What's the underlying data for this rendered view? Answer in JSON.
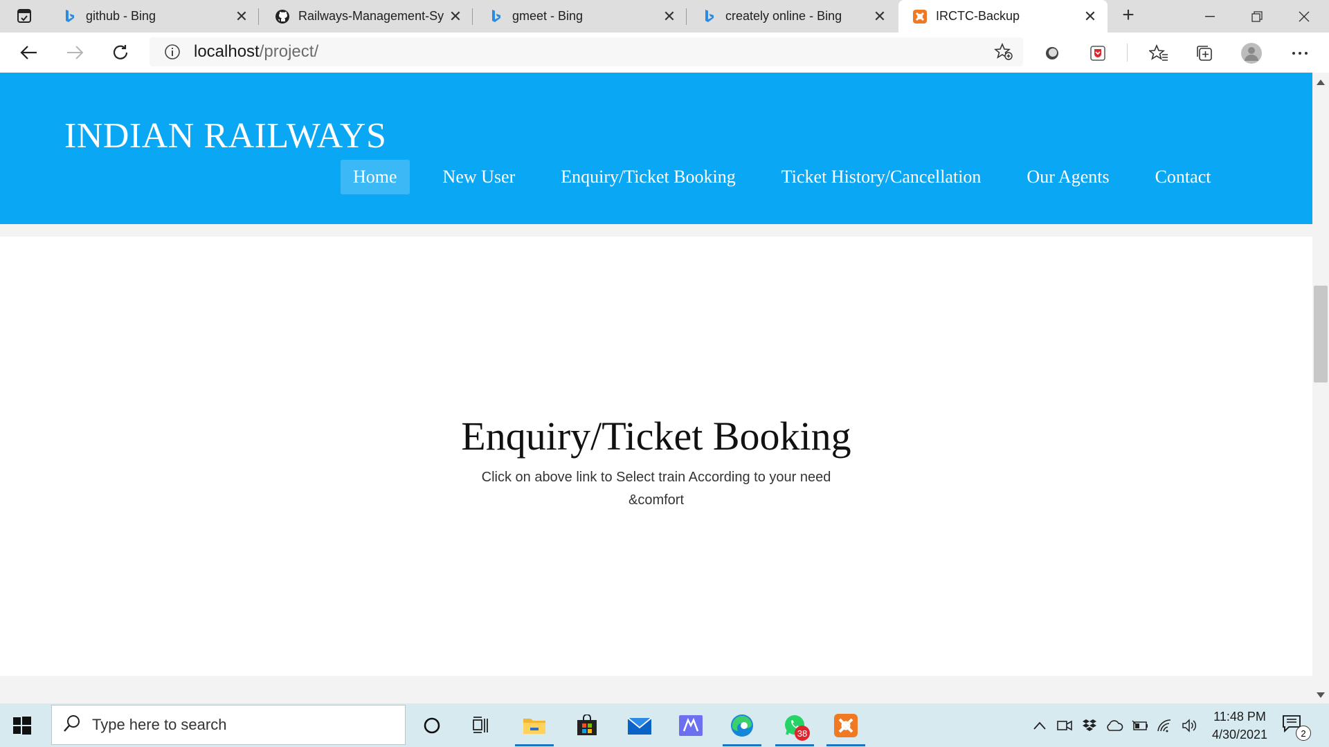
{
  "browser": {
    "tabs": [
      {
        "title": "github - Bing",
        "icon": "bing-icon",
        "active": false
      },
      {
        "title": "Railways-Management-Sy",
        "icon": "github-icon",
        "active": false
      },
      {
        "title": "gmeet - Bing",
        "icon": "bing-icon",
        "active": false
      },
      {
        "title": "creately online - Bing",
        "icon": "bing-icon",
        "active": false
      },
      {
        "title": "IRCTC-Backup",
        "icon": "xampp-icon",
        "active": true
      }
    ],
    "address": {
      "host": "localhost",
      "path": "/project/"
    }
  },
  "site": {
    "title": "INDIAN RAILWAYS",
    "nav": [
      {
        "label": "Home",
        "active": true
      },
      {
        "label": "New User",
        "active": false
      },
      {
        "label": "Enquiry/Ticket Booking",
        "active": false
      },
      {
        "label": "Ticket History/Cancellation",
        "active": false
      },
      {
        "label": "Our Agents",
        "active": false
      },
      {
        "label": "Contact",
        "active": false
      }
    ],
    "hero": {
      "title": "Enquiry/Ticket Booking",
      "subtitle": "Click on above link to Select train According to your need &comfort"
    },
    "colors": {
      "header": "#0aa7f5",
      "active_nav": "#3bb9f7"
    }
  },
  "taskbar": {
    "search_placeholder": "Type here to search",
    "whatsapp_badge": "38",
    "time": "11:48 PM",
    "date": "4/30/2021",
    "notification_count": "2"
  }
}
